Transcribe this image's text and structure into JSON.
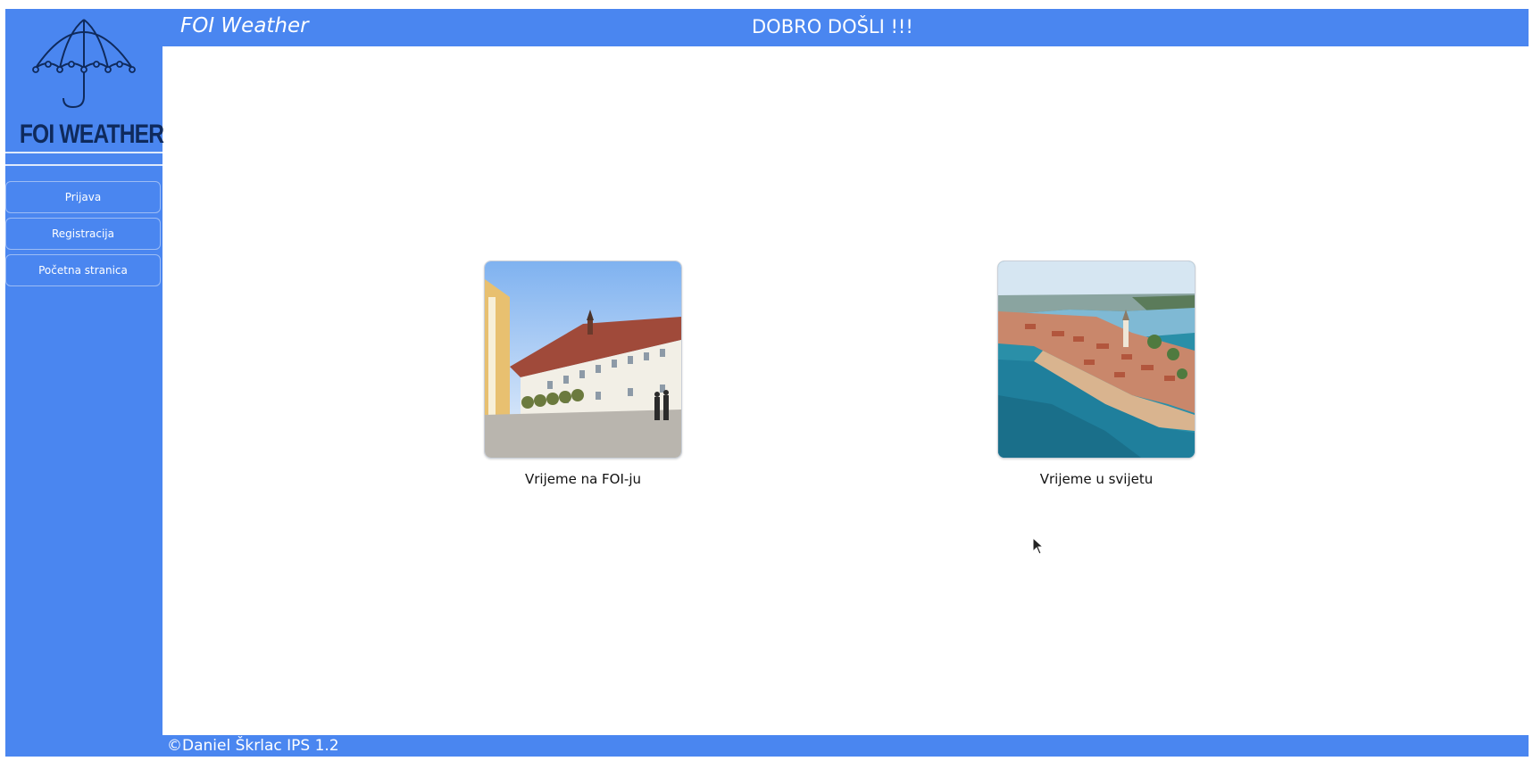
{
  "app": {
    "brand": "FOI Weather",
    "welcome": "DOBRO DOŠLI !!!",
    "logo_text": "FOI WEATHER",
    "logo_icon": "umbrella-icon"
  },
  "sidebar": {
    "items": [
      {
        "label": "Prijava"
      },
      {
        "label": "Registracija"
      },
      {
        "label": "Početna stranica"
      }
    ]
  },
  "main": {
    "cards": [
      {
        "caption": "Vrijeme na FOI-ju",
        "image": "foi-building-photo"
      },
      {
        "caption": "Vrijeme u svijetu",
        "image": "coastal-town-aerial-photo"
      }
    ]
  },
  "footer": {
    "text": "©Daniel Škrlac IPS 1.2"
  },
  "colors": {
    "accent": "#4a86f0",
    "logo_text": "#0f2a5c",
    "background": "#ffffff"
  }
}
